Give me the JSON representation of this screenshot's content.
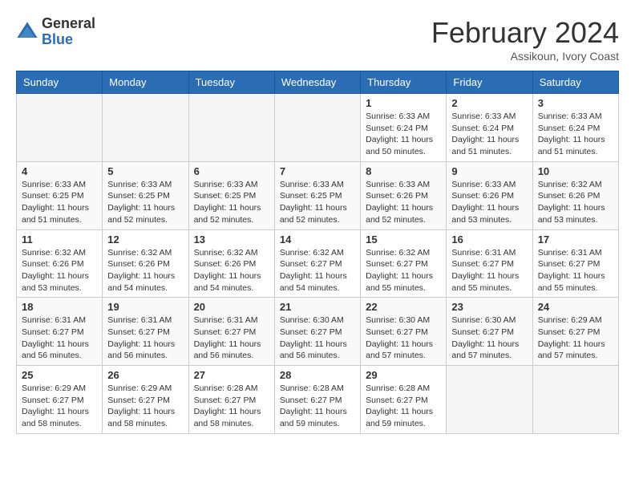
{
  "logo": {
    "general": "General",
    "blue": "Blue"
  },
  "title": "February 2024",
  "subtitle": "Assikoun, Ivory Coast",
  "days_of_week": [
    "Sunday",
    "Monday",
    "Tuesday",
    "Wednesday",
    "Thursday",
    "Friday",
    "Saturday"
  ],
  "weeks": [
    [
      {
        "day": "",
        "sunrise": "",
        "sunset": "",
        "daylight": ""
      },
      {
        "day": "",
        "sunrise": "",
        "sunset": "",
        "daylight": ""
      },
      {
        "day": "",
        "sunrise": "",
        "sunset": "",
        "daylight": ""
      },
      {
        "day": "",
        "sunrise": "",
        "sunset": "",
        "daylight": ""
      },
      {
        "day": "1",
        "sunrise": "Sunrise: 6:33 AM",
        "sunset": "Sunset: 6:24 PM",
        "daylight": "Daylight: 11 hours and 50 minutes."
      },
      {
        "day": "2",
        "sunrise": "Sunrise: 6:33 AM",
        "sunset": "Sunset: 6:24 PM",
        "daylight": "Daylight: 11 hours and 51 minutes."
      },
      {
        "day": "3",
        "sunrise": "Sunrise: 6:33 AM",
        "sunset": "Sunset: 6:24 PM",
        "daylight": "Daylight: 11 hours and 51 minutes."
      }
    ],
    [
      {
        "day": "4",
        "sunrise": "Sunrise: 6:33 AM",
        "sunset": "Sunset: 6:25 PM",
        "daylight": "Daylight: 11 hours and 51 minutes."
      },
      {
        "day": "5",
        "sunrise": "Sunrise: 6:33 AM",
        "sunset": "Sunset: 6:25 PM",
        "daylight": "Daylight: 11 hours and 52 minutes."
      },
      {
        "day": "6",
        "sunrise": "Sunrise: 6:33 AM",
        "sunset": "Sunset: 6:25 PM",
        "daylight": "Daylight: 11 hours and 52 minutes."
      },
      {
        "day": "7",
        "sunrise": "Sunrise: 6:33 AM",
        "sunset": "Sunset: 6:25 PM",
        "daylight": "Daylight: 11 hours and 52 minutes."
      },
      {
        "day": "8",
        "sunrise": "Sunrise: 6:33 AM",
        "sunset": "Sunset: 6:26 PM",
        "daylight": "Daylight: 11 hours and 52 minutes."
      },
      {
        "day": "9",
        "sunrise": "Sunrise: 6:33 AM",
        "sunset": "Sunset: 6:26 PM",
        "daylight": "Daylight: 11 hours and 53 minutes."
      },
      {
        "day": "10",
        "sunrise": "Sunrise: 6:32 AM",
        "sunset": "Sunset: 6:26 PM",
        "daylight": "Daylight: 11 hours and 53 minutes."
      }
    ],
    [
      {
        "day": "11",
        "sunrise": "Sunrise: 6:32 AM",
        "sunset": "Sunset: 6:26 PM",
        "daylight": "Daylight: 11 hours and 53 minutes."
      },
      {
        "day": "12",
        "sunrise": "Sunrise: 6:32 AM",
        "sunset": "Sunset: 6:26 PM",
        "daylight": "Daylight: 11 hours and 54 minutes."
      },
      {
        "day": "13",
        "sunrise": "Sunrise: 6:32 AM",
        "sunset": "Sunset: 6:26 PM",
        "daylight": "Daylight: 11 hours and 54 minutes."
      },
      {
        "day": "14",
        "sunrise": "Sunrise: 6:32 AM",
        "sunset": "Sunset: 6:27 PM",
        "daylight": "Daylight: 11 hours and 54 minutes."
      },
      {
        "day": "15",
        "sunrise": "Sunrise: 6:32 AM",
        "sunset": "Sunset: 6:27 PM",
        "daylight": "Daylight: 11 hours and 55 minutes."
      },
      {
        "day": "16",
        "sunrise": "Sunrise: 6:31 AM",
        "sunset": "Sunset: 6:27 PM",
        "daylight": "Daylight: 11 hours and 55 minutes."
      },
      {
        "day": "17",
        "sunrise": "Sunrise: 6:31 AM",
        "sunset": "Sunset: 6:27 PM",
        "daylight": "Daylight: 11 hours and 55 minutes."
      }
    ],
    [
      {
        "day": "18",
        "sunrise": "Sunrise: 6:31 AM",
        "sunset": "Sunset: 6:27 PM",
        "daylight": "Daylight: 11 hours and 56 minutes."
      },
      {
        "day": "19",
        "sunrise": "Sunrise: 6:31 AM",
        "sunset": "Sunset: 6:27 PM",
        "daylight": "Daylight: 11 hours and 56 minutes."
      },
      {
        "day": "20",
        "sunrise": "Sunrise: 6:31 AM",
        "sunset": "Sunset: 6:27 PM",
        "daylight": "Daylight: 11 hours and 56 minutes."
      },
      {
        "day": "21",
        "sunrise": "Sunrise: 6:30 AM",
        "sunset": "Sunset: 6:27 PM",
        "daylight": "Daylight: 11 hours and 56 minutes."
      },
      {
        "day": "22",
        "sunrise": "Sunrise: 6:30 AM",
        "sunset": "Sunset: 6:27 PM",
        "daylight": "Daylight: 11 hours and 57 minutes."
      },
      {
        "day": "23",
        "sunrise": "Sunrise: 6:30 AM",
        "sunset": "Sunset: 6:27 PM",
        "daylight": "Daylight: 11 hours and 57 minutes."
      },
      {
        "day": "24",
        "sunrise": "Sunrise: 6:29 AM",
        "sunset": "Sunset: 6:27 PM",
        "daylight": "Daylight: 11 hours and 57 minutes."
      }
    ],
    [
      {
        "day": "25",
        "sunrise": "Sunrise: 6:29 AM",
        "sunset": "Sunset: 6:27 PM",
        "daylight": "Daylight: 11 hours and 58 minutes."
      },
      {
        "day": "26",
        "sunrise": "Sunrise: 6:29 AM",
        "sunset": "Sunset: 6:27 PM",
        "daylight": "Daylight: 11 hours and 58 minutes."
      },
      {
        "day": "27",
        "sunrise": "Sunrise: 6:28 AM",
        "sunset": "Sunset: 6:27 PM",
        "daylight": "Daylight: 11 hours and 58 minutes."
      },
      {
        "day": "28",
        "sunrise": "Sunrise: 6:28 AM",
        "sunset": "Sunset: 6:27 PM",
        "daylight": "Daylight: 11 hours and 59 minutes."
      },
      {
        "day": "29",
        "sunrise": "Sunrise: 6:28 AM",
        "sunset": "Sunset: 6:27 PM",
        "daylight": "Daylight: 11 hours and 59 minutes."
      },
      {
        "day": "",
        "sunrise": "",
        "sunset": "",
        "daylight": ""
      },
      {
        "day": "",
        "sunrise": "",
        "sunset": "",
        "daylight": ""
      }
    ]
  ]
}
